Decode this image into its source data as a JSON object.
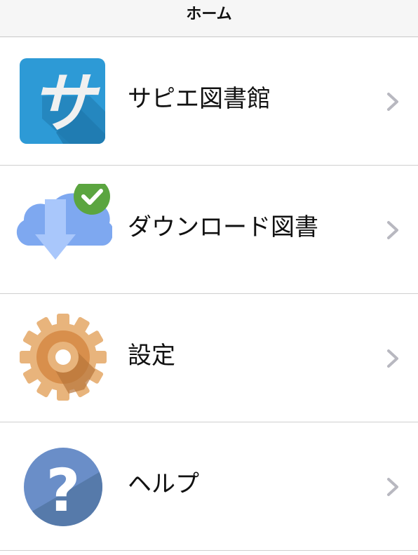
{
  "header": {
    "title": "ホーム"
  },
  "menu": {
    "items": [
      {
        "label": "サピエ図書館",
        "icon": "sapie-library-icon",
        "icon_text": "サ"
      },
      {
        "label": "ダウンロード図書",
        "icon": "cloud-download-icon"
      },
      {
        "label": "設定",
        "icon": "gear-icon"
      },
      {
        "label": "ヘルプ",
        "icon": "help-icon",
        "icon_text": "?"
      }
    ]
  },
  "colors": {
    "navbar_bg": "#f6f6f6",
    "divider": "#cfcfcf",
    "chevron": "#b8b8c0",
    "sapie_blue": "#2d9ad6",
    "cloud_blue": "#7ea8f0",
    "check_green": "#5ba540",
    "gear_orange": "#e1a060",
    "help_blue": "#6a8ec8"
  }
}
